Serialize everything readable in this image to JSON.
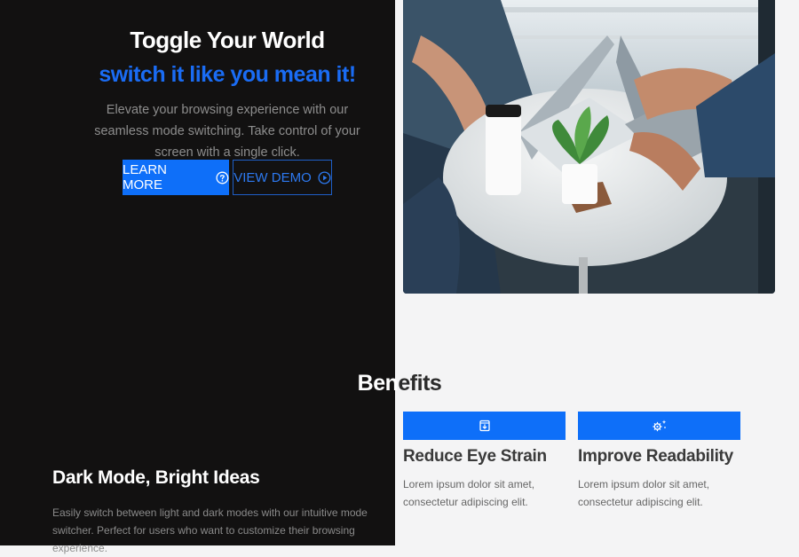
{
  "hero": {
    "title": "Toggle Your World",
    "subtitle": "switch it like you mean it!",
    "description": "Elevate your browsing experience with our seamless mode switching. Take control of your screen with a single click.",
    "learn_more_label": "LEARN MORE",
    "learn_more_icon": "question-circle-icon",
    "view_demo_label": "VIEW DEMO",
    "view_demo_icon": "play-circle-icon",
    "photo_description": "Two people working on laptops at a round white table with coffee cup and potted plant"
  },
  "benefits": {
    "title_part_1": "Ben",
    "title_part_2": "efits",
    "cards": [
      {
        "icon": "save-download-icon",
        "title": "Reduce Eye Strain",
        "text": "Lorem ipsum dolor sit amet, consectetur adipiscing elit."
      },
      {
        "icon": "settings-sparkle-icon",
        "title": "Improve Readability",
        "text": "Lorem ipsum dolor sit amet, consectetur adipiscing elit."
      }
    ]
  },
  "dark_mode": {
    "title": "Dark Mode, Bright Ideas",
    "text": "Easily switch between light and dark modes with our intuitive mode switcher. Perfect for users who want to customize their browsing experience."
  },
  "colors": {
    "dark_bg": "#121111",
    "light_bg": "#f4f4f5",
    "accent": "#0e6ff9"
  }
}
